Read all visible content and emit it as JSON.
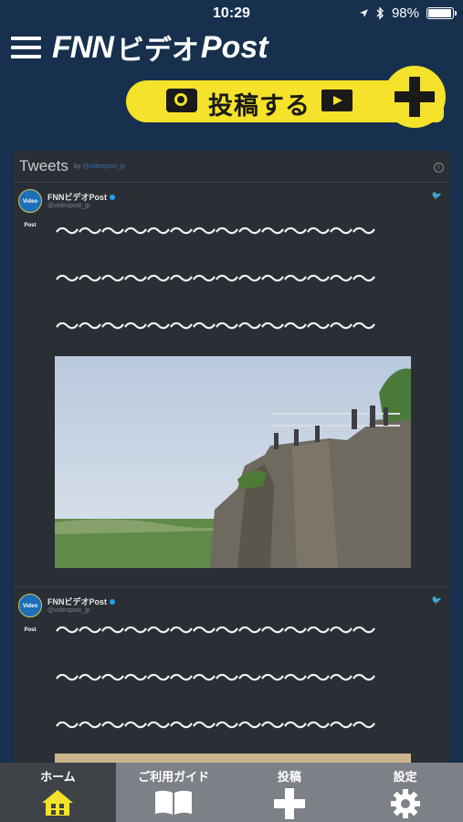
{
  "status_bar": {
    "time": "10:29",
    "battery": "98%",
    "battery_level": 0.98
  },
  "app": {
    "logo_prefix": "FNN",
    "logo_middle": "ビデオ",
    "logo_suffix": "Post"
  },
  "post_banner": {
    "label": "投稿する"
  },
  "widget": {
    "title": "Tweets",
    "by_prefix": "by",
    "by_handle": "@videopost_jp"
  },
  "tweets": [
    {
      "name": "FNNビデオPost",
      "handle": "@videopost_jp",
      "avatar_text": "Video Post",
      "lines": [
        "〜〜〜〜〜〜〜〜〜〜〜〜〜〜",
        "〜〜〜〜〜〜〜〜〜〜〜〜〜〜",
        "〜〜〜〜〜〜〜〜〜〜〜〜〜〜"
      ]
    },
    {
      "name": "FNNビデオPost",
      "handle": "@videopost_jp",
      "avatar_text": "Video Post",
      "lines": [
        "〜〜〜〜〜〜〜〜〜〜〜〜〜〜",
        "〜〜〜〜〜〜〜〜〜〜〜〜〜〜",
        "〜〜〜〜〜〜〜〜〜〜〜〜〜〜"
      ]
    }
  ],
  "tabs": [
    {
      "label": "ホーム",
      "icon": "home-icon",
      "active": true
    },
    {
      "label": "ご利用ガイド",
      "icon": "book-icon",
      "active": false
    },
    {
      "label": "投稿",
      "icon": "plus-icon",
      "active": false
    },
    {
      "label": "設定",
      "icon": "gear-icon",
      "active": false
    }
  ],
  "colors": {
    "background": "#16304d",
    "accent": "#f4e22b",
    "widget_bg": "#2a2f35",
    "tabbar": "#7d8187",
    "tab_active": "#3f4348"
  }
}
